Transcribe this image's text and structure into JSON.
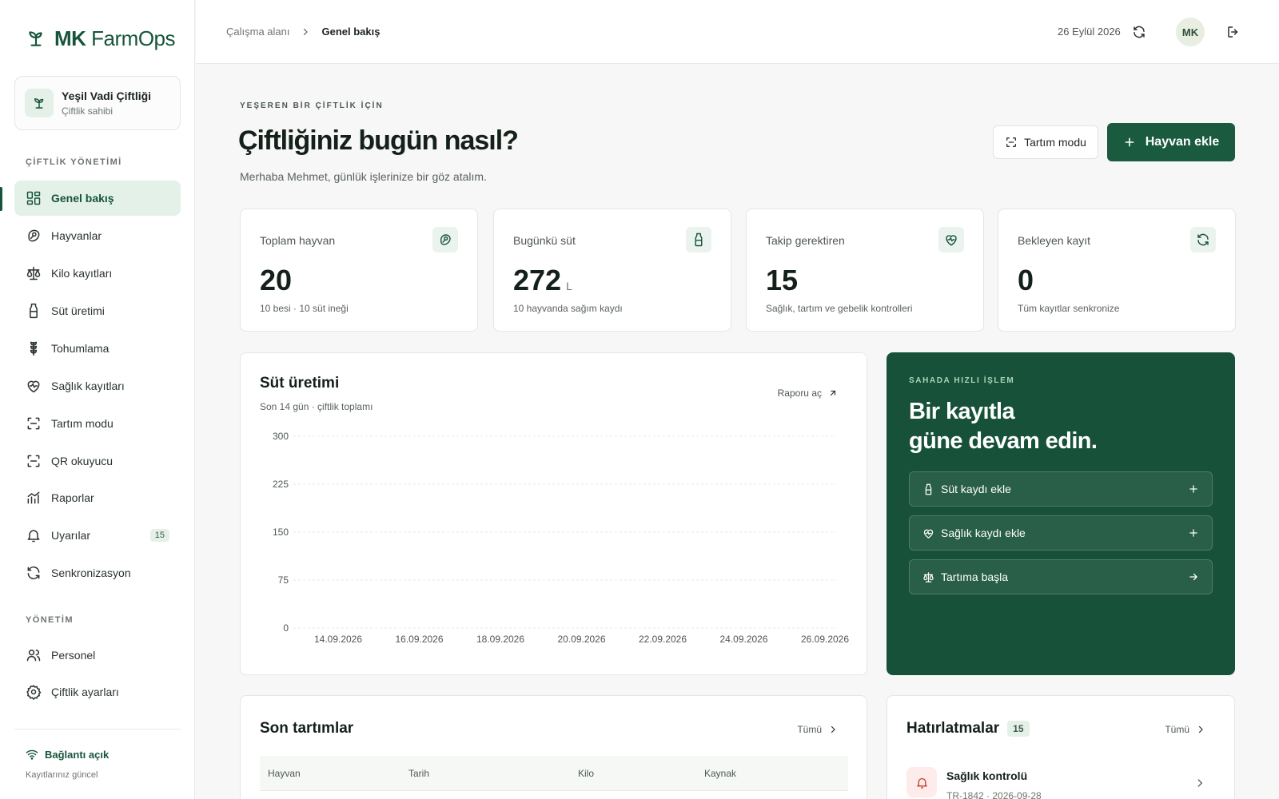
{
  "app": {
    "brand_bold": "MK",
    "brand_rest": "FarmOps"
  },
  "farm": {
    "name": "Yeşil Vadi Çiftliği",
    "role": "Çiftlik sahibi"
  },
  "sidebar": {
    "section_farm": "ÇİFTLİK YÖNETİMİ",
    "section_admin": "YÖNETİM",
    "items": [
      {
        "label": "Genel bakış",
        "icon": "dashboard-icon",
        "active": true
      },
      {
        "label": "Hayvanlar",
        "icon": "animal-icon"
      },
      {
        "label": "Kilo kayıtları",
        "icon": "scale-icon"
      },
      {
        "label": "Süt üretimi",
        "icon": "milk-bottle-icon"
      },
      {
        "label": "Tohumlama",
        "icon": "wheat-icon"
      },
      {
        "label": "Sağlık kayıtları",
        "icon": "heart-pulse-icon"
      },
      {
        "label": "Tartım modu",
        "icon": "scan-icon"
      },
      {
        "label": "QR okuyucu",
        "icon": "qr-scan-icon"
      },
      {
        "label": "Raporlar",
        "icon": "chart-icon"
      },
      {
        "label": "Uyarılar",
        "icon": "bell-icon",
        "count": "15"
      },
      {
        "label": "Senkronizasyon",
        "icon": "sync-icon"
      }
    ],
    "admin_items": [
      {
        "label": "Personel",
        "icon": "users-icon"
      },
      {
        "label": "Çiftlik ayarları",
        "icon": "gear-icon"
      }
    ],
    "connection": {
      "label": "Bağlantı açık",
      "sub": "Kayıtlarınız güncel"
    }
  },
  "topbar": {
    "breadcrumb_root": "Çalışma alanı",
    "breadcrumb_current": "Genel bakış",
    "date": "26 Eylül 2026",
    "avatar": "MK"
  },
  "header": {
    "eyebrow": "YEŞEREN BİR ÇİFTLİK İÇİN",
    "title": "Çiftliğiniz bugün nasıl?",
    "subtitle": "Merhaba Mehmet, günlük işlerinize bir göz atalım.",
    "weigh_button": "Tartım modu",
    "add_button": "Hayvan ekle"
  },
  "stats": [
    {
      "label": "Toplam hayvan",
      "value": "20",
      "unit": "",
      "foot": "10 besi · 10 süt ineği",
      "icon": "animal-icon"
    },
    {
      "label": "Bugünkü süt",
      "value": "272",
      "unit": "L",
      "foot": "10 hayvanda sağım kaydı",
      "icon": "milk-bottle-icon"
    },
    {
      "label": "Takip gerektiren",
      "value": "15",
      "unit": "",
      "foot": "Sağlık, tartım ve gebelik kontrolleri",
      "icon": "heart-pulse-icon"
    },
    {
      "label": "Bekleyen kayıt",
      "value": "0",
      "unit": "",
      "foot": "Tüm kayıtlar senkronize",
      "icon": "sync-icon"
    }
  ],
  "milk_card": {
    "title": "Süt üretimi",
    "subtitle": "Son 14 gün · çiftlik toplamı",
    "link": "Raporu aç"
  },
  "chart_data": {
    "type": "line",
    "title": "Süt üretimi",
    "subtitle": "Son 14 gün · çiftlik toplamı",
    "ylim": [
      0,
      300
    ],
    "y_ticks": [
      "300",
      "225",
      "150",
      "75",
      "0"
    ],
    "x_ticks": [
      "14.09.2026",
      "16.09.2026",
      "18.09.2026",
      "20.09.2026",
      "22.09.2026",
      "24.09.2026",
      "26.09.2026"
    ],
    "series": [],
    "grid": true
  },
  "quick": {
    "eyebrow": "SAHADA HIZLI İŞLEM",
    "title_line1": "Bir kayıtla",
    "title_line2": "güne devam edin.",
    "actions": [
      {
        "label": "Süt kaydı ekle",
        "icon": "milk-bottle-icon",
        "tail": "plus-icon"
      },
      {
        "label": "Sağlık kaydı ekle",
        "icon": "heart-pulse-icon",
        "tail": "plus-icon"
      },
      {
        "label": "Tartıma başla",
        "icon": "scale-icon",
        "tail": "arrow-right-icon"
      }
    ]
  },
  "weighings": {
    "title": "Son tartımlar",
    "link": "Tümü",
    "columns": [
      "Hayvan",
      "Tarih",
      "Kilo",
      "Kaynak"
    ]
  },
  "reminders": {
    "title": "Hatırlatmalar",
    "count": "15",
    "link": "Tümü",
    "first": {
      "title": "Sağlık kontrolü",
      "sub": "TR-1842 · 2026-09-28"
    }
  }
}
